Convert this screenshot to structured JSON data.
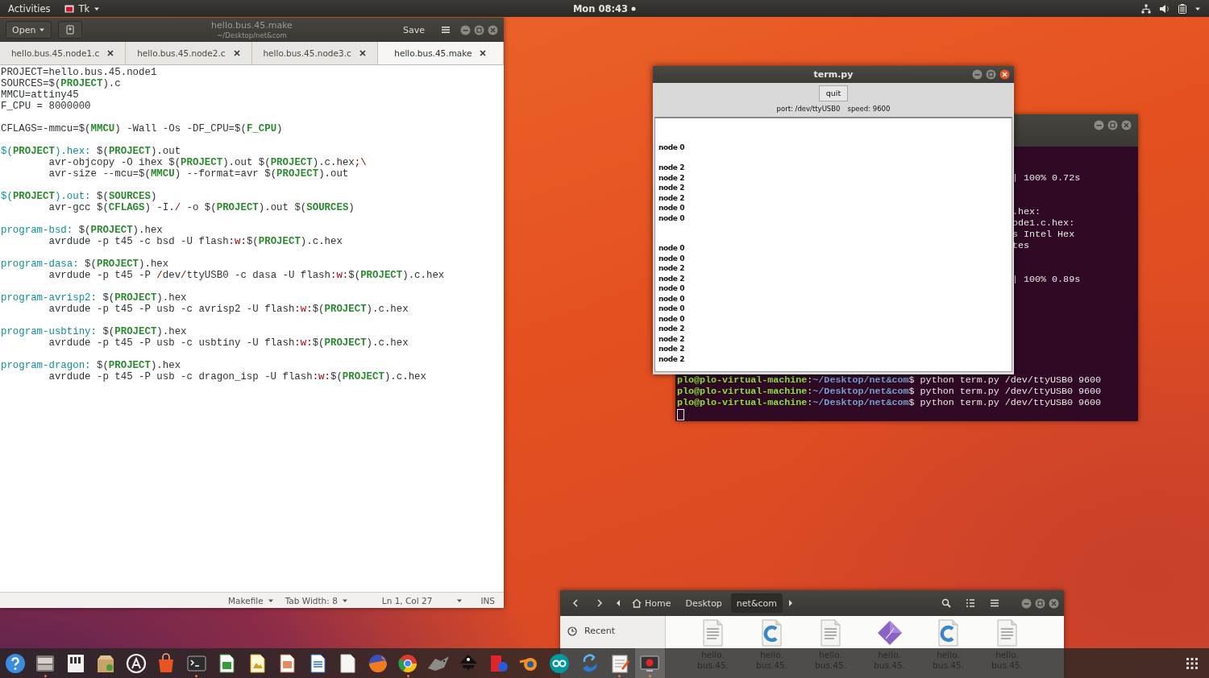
{
  "top_bar": {
    "activities": "Activities",
    "app_menu": "Tk",
    "clock": "Mon 08:43"
  },
  "editor": {
    "open_button": "Open",
    "title": "hello.bus.45.make",
    "subtitle": "~/Desktop/net&com",
    "save_button": "Save",
    "tabs": [
      {
        "label": "hello.bus.45.node1.c",
        "selected": false
      },
      {
        "label": "hello.bus.45.node2.c",
        "selected": false
      },
      {
        "label": "hello.bus.45.node3.c",
        "selected": false
      },
      {
        "label": "hello.bus.45.make",
        "selected": true
      }
    ],
    "code": [
      [
        [
          {
            "text": "PROJECT=hello.bus.45.node1",
            "kind": "plain"
          }
        ],
        [
          {
            "text": "SOURCES=$(",
            "kind": "plain"
          },
          {
            "text": "PROJECT",
            "kind": "var"
          },
          {
            "text": ").c",
            "kind": "plain"
          }
        ],
        [
          {
            "text": "MMCU=attiny45",
            "kind": "plain"
          }
        ],
        [
          {
            "text": "F_CPU = 8000000",
            "kind": "plain"
          }
        ]
      ],
      [
        [
          {
            "text": "CFLAGS=-mmcu=$(",
            "kind": "plain"
          },
          {
            "text": "MMCU",
            "kind": "var"
          },
          {
            "text": ") -Wall -Os -DF_CPU=$(",
            "kind": "plain"
          },
          {
            "text": "F_CPU",
            "kind": "var"
          },
          {
            "text": ")",
            "kind": "plain"
          }
        ]
      ],
      [
        [
          {
            "text": "$(",
            "kind": "target"
          },
          {
            "text": "PROJECT",
            "kind": "var"
          },
          {
            "text": ").hex:",
            "kind": "target"
          },
          {
            "text": " $(",
            "kind": "plain"
          },
          {
            "text": "PROJECT",
            "kind": "var"
          },
          {
            "text": ").out",
            "kind": "plain"
          }
        ],
        [
          {
            "text": "\tavr-objcopy -O ihex $(",
            "kind": "plain"
          },
          {
            "text": "PROJECT",
            "kind": "var"
          },
          {
            "text": ").out $(",
            "kind": "plain"
          },
          {
            "text": "PROJECT",
            "kind": "var"
          },
          {
            "text": ").c.hex",
            "kind": "plain"
          },
          {
            "text": ";\\",
            "kind": "special"
          }
        ],
        [
          {
            "text": "\tavr-size --mcu=$(",
            "kind": "plain"
          },
          {
            "text": "MMCU",
            "kind": "var"
          },
          {
            "text": ") --format=avr $(",
            "kind": "plain"
          },
          {
            "text": "PROJECT",
            "kind": "var"
          },
          {
            "text": ").out",
            "kind": "plain"
          }
        ]
      ],
      [
        [
          {
            "text": "$(",
            "kind": "target"
          },
          {
            "text": "PROJECT",
            "kind": "var"
          },
          {
            "text": ").out:",
            "kind": "target"
          },
          {
            "text": " $(",
            "kind": "plain"
          },
          {
            "text": "SOURCES",
            "kind": "var"
          },
          {
            "text": ")",
            "kind": "plain"
          }
        ],
        [
          {
            "text": "\tavr-gcc $(",
            "kind": "plain"
          },
          {
            "text": "CFLAGS",
            "kind": "var"
          },
          {
            "text": ") -I.",
            "kind": "plain"
          },
          {
            "text": "/",
            "kind": "special"
          },
          {
            "text": " -o $(",
            "kind": "plain"
          },
          {
            "text": "PROJECT",
            "kind": "var"
          },
          {
            "text": ").out $(",
            "kind": "plain"
          },
          {
            "text": "SOURCES",
            "kind": "var"
          },
          {
            "text": ")",
            "kind": "plain"
          }
        ]
      ],
      [
        [
          {
            "text": "program-bsd:",
            "kind": "target"
          },
          {
            "text": " $(",
            "kind": "plain"
          },
          {
            "text": "PROJECT",
            "kind": "var"
          },
          {
            "text": ").hex",
            "kind": "plain"
          }
        ],
        [
          {
            "text": "\tavrdude -p t45 -c bsd -U flash",
            "kind": "plain"
          },
          {
            "text": ":w:",
            "kind": "special"
          },
          {
            "text": "$(",
            "kind": "plain"
          },
          {
            "text": "PROJECT",
            "kind": "var"
          },
          {
            "text": ").c.hex",
            "kind": "plain"
          }
        ]
      ],
      [
        [
          {
            "text": "program-dasa:",
            "kind": "target"
          },
          {
            "text": " $(",
            "kind": "plain"
          },
          {
            "text": "PROJECT",
            "kind": "var"
          },
          {
            "text": ").hex",
            "kind": "plain"
          }
        ],
        [
          {
            "text": "\tavrdude -p t45 -P ",
            "kind": "plain"
          },
          {
            "text": "/",
            "kind": "special"
          },
          {
            "text": "dev",
            "kind": "plain"
          },
          {
            "text": "/",
            "kind": "special"
          },
          {
            "text": "ttyUSB0 -c dasa -U flash",
            "kind": "plain"
          },
          {
            "text": ":w:",
            "kind": "special"
          },
          {
            "text": "$(",
            "kind": "plain"
          },
          {
            "text": "PROJECT",
            "kind": "var"
          },
          {
            "text": ").c.hex",
            "kind": "plain"
          }
        ]
      ],
      [
        [
          {
            "text": "program-avrisp2:",
            "kind": "target"
          },
          {
            "text": " $(",
            "kind": "plain"
          },
          {
            "text": "PROJECT",
            "kind": "var"
          },
          {
            "text": ").hex",
            "kind": "plain"
          }
        ],
        [
          {
            "text": "\tavrdude -p t45 -P usb -c avrisp2 -U flash",
            "kind": "plain"
          },
          {
            "text": ":w:",
            "kind": "special"
          },
          {
            "text": "$(",
            "kind": "plain"
          },
          {
            "text": "PROJECT",
            "kind": "var"
          },
          {
            "text": ").c.hex",
            "kind": "plain"
          }
        ]
      ],
      [
        [
          {
            "text": "program-usbtiny:",
            "kind": "target"
          },
          {
            "text": " $(",
            "kind": "plain"
          },
          {
            "text": "PROJECT",
            "kind": "var"
          },
          {
            "text": ").hex",
            "kind": "plain"
          }
        ],
        [
          {
            "text": "\tavrdude -p t45 -P usb -c usbtiny -U flash",
            "kind": "plain"
          },
          {
            "text": ":w:",
            "kind": "special"
          },
          {
            "text": "$(",
            "kind": "plain"
          },
          {
            "text": "PROJECT",
            "kind": "var"
          },
          {
            "text": ").c.hex",
            "kind": "plain"
          }
        ]
      ],
      [
        [
          {
            "text": "program-dragon:",
            "kind": "target"
          },
          {
            "text": " $(",
            "kind": "plain"
          },
          {
            "text": "PROJECT",
            "kind": "var"
          },
          {
            "text": ").hex",
            "kind": "plain"
          }
        ],
        [
          {
            "text": "\tavrdude -p t45 -P usb -c dragon_isp -U flash",
            "kind": "plain"
          },
          {
            "text": ":w:",
            "kind": "special"
          },
          {
            "text": "$(",
            "kind": "plain"
          },
          {
            "text": "PROJECT",
            "kind": "var"
          },
          {
            "text": ").c.hex",
            "kind": "plain"
          }
        ]
      ]
    ],
    "status_bar": {
      "language": "Makefile",
      "tab_width": "Tab Width: 8",
      "position": "Ln 1, Col 27",
      "mode": "INS"
    }
  },
  "terminal": {
    "output": [
      [
        "| 100% 0.72s"
      ],
      [
        ".hex:",
        "ode1.c.hex:",
        "s Intel Hex",
        "tes"
      ],
      [
        "| 100% 0.89s"
      ]
    ],
    "prompts": [
      {
        "user": "plo@plo-virtual-machine",
        "separator": ":",
        "path": "~/Desktop/net&com",
        "command": "$ python term.py /dev/ttyUSB0 9600"
      },
      {
        "user": "plo@plo-virtual-machine",
        "separator": ":",
        "path": "~/Desktop/net&com",
        "command": "$ python term.py /dev/ttyUSB0 9600"
      },
      {
        "user": "plo@plo-virtual-machine",
        "separator": ":",
        "path": "~/Desktop/net&com",
        "command": "$ python term.py /dev/ttyUSB0 9600"
      }
    ]
  },
  "tk_app": {
    "title": "term.py",
    "quit_button": "quit",
    "port": "port: /dev/ttyUSB0",
    "speed": "speed: 9600",
    "received": [
      [
        "node 0"
      ],
      [
        "node 2",
        "node 2",
        "node 2",
        "node 2",
        "node 0",
        "node 0"
      ],
      [
        "node 0",
        "node 0",
        "node 2",
        "node 2",
        "node 0",
        "node 0",
        "node 0",
        "node 0",
        "node 2",
        "node 2",
        "node 2",
        "node 2"
      ]
    ]
  },
  "files": {
    "path": [
      {
        "label": "Home",
        "selected": false
      },
      {
        "label": "Desktop",
        "selected": false
      },
      {
        "label": "net&com",
        "selected": true
      }
    ],
    "sidebar": [
      {
        "label": "Recent"
      }
    ],
    "items": [
      {
        "lines": [
          "hello.",
          "bus.45."
        ],
        "kind": "text"
      },
      {
        "lines": [
          "hello.",
          "bus.45."
        ],
        "kind": "c"
      },
      {
        "lines": [
          "hello.",
          "bus.45."
        ],
        "kind": "text"
      },
      {
        "lines": [
          "hello.",
          "bus.45."
        ],
        "kind": "model"
      },
      {
        "lines": [
          "hello.",
          "bus.45."
        ],
        "kind": "c"
      },
      {
        "lines": [
          "hello.",
          "bus.45."
        ],
        "kind": "text"
      }
    ]
  },
  "dock": {
    "items": [
      {
        "running": false,
        "selected": false
      },
      {
        "running": true,
        "selected": false
      },
      {
        "running": false,
        "selected": false
      },
      {
        "running": false,
        "selected": false
      },
      {
        "running": false,
        "selected": false
      },
      {
        "running": false,
        "selected": false
      },
      {
        "running": true,
        "selected": false
      },
      {
        "running": false,
        "selected": false
      },
      {
        "running": false,
        "selected": false
      },
      {
        "running": false,
        "selected": false
      },
      {
        "running": false,
        "selected": false
      },
      {
        "running": false,
        "selected": false
      },
      {
        "running": false,
        "selected": false
      },
      {
        "running": true,
        "selected": false
      },
      {
        "running": false,
        "selected": false
      },
      {
        "running": false,
        "selected": false
      },
      {
        "running": false,
        "selected": false
      },
      {
        "running": false,
        "selected": false
      },
      {
        "running": false,
        "selected": false
      },
      {
        "running": false,
        "selected": false
      },
      {
        "running": true,
        "selected": false
      },
      {
        "running": true,
        "selected": true
      }
    ]
  }
}
